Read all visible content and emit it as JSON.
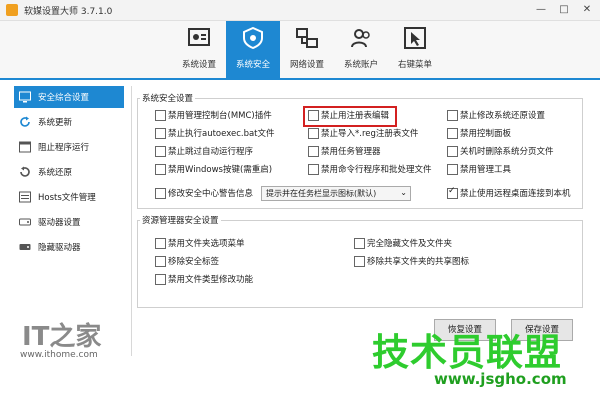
{
  "window": {
    "title": "软媒设置大师 3.7.1.0",
    "minimize": "—",
    "maximize": "□",
    "close": "✕"
  },
  "toolbar": {
    "items": [
      {
        "label": "系统设置"
      },
      {
        "label": "系统安全"
      },
      {
        "label": "网络设置"
      },
      {
        "label": "系统账户"
      },
      {
        "label": "右键菜单"
      }
    ],
    "active_index": 1
  },
  "sidebar": {
    "items": [
      {
        "label": "安全综合设置",
        "icon": "monitor-icon"
      },
      {
        "label": "系统更新",
        "icon": "refresh-icon"
      },
      {
        "label": "阻止程序运行",
        "icon": "window-icon"
      },
      {
        "label": "系统还原",
        "icon": "restore-icon"
      },
      {
        "label": "Hosts文件管理",
        "icon": "hosts-icon"
      },
      {
        "label": "驱动器设置",
        "icon": "drive-icon"
      },
      {
        "label": "隐藏驱动器",
        "icon": "hidden-drive-icon"
      }
    ],
    "active_index": 0
  },
  "security": {
    "title": "系统安全设置",
    "options": [
      {
        "label": "禁用管理控制台(MMC)插件",
        "checked": false
      },
      {
        "label": "禁止用注册表编辑",
        "checked": false
      },
      {
        "label": "禁止修改系统还原设置",
        "checked": false
      },
      {
        "label": "禁止执行autoexec.bat文件",
        "checked": false
      },
      {
        "label": "禁止导入*.reg注册表文件",
        "checked": false
      },
      {
        "label": "禁用控制面板",
        "checked": false
      },
      {
        "label": "禁止跳过自动运行程序",
        "checked": false
      },
      {
        "label": "禁用任务管理器",
        "checked": false
      },
      {
        "label": "关机时删除系统分页文件",
        "checked": false
      },
      {
        "label": "禁用Windows按键(需重启)",
        "checked": false
      },
      {
        "label": "禁用命令行程序和批处理文件",
        "checked": false
      },
      {
        "label": "禁用管理工具",
        "checked": false
      },
      {
        "label": "修改安全中心警告信息",
        "checked": false
      },
      {
        "label": "禁止使用远程桌面连接到本机",
        "checked": true
      }
    ],
    "security_center_select": "提示并在任务栏显示图标(默认)"
  },
  "explorer": {
    "title": "资源管理器安全设置",
    "options": [
      {
        "label": "禁用文件夹选项菜单",
        "checked": false
      },
      {
        "label": "完全隐藏文件及文件夹",
        "checked": false
      },
      {
        "label": "移除安全标签",
        "checked": false
      },
      {
        "label": "移除共享文件夹的共享图标",
        "checked": false
      },
      {
        "label": "禁用文件类型修改功能",
        "checked": false
      }
    ]
  },
  "buttons": {
    "restore": "恢复设置",
    "save": "保存设置"
  },
  "watermark": {
    "it_logo": "IT之家",
    "it_url": "www.ithome.com",
    "lm_title": "技术员联盟",
    "lm_url": "www.jsgho.com"
  }
}
